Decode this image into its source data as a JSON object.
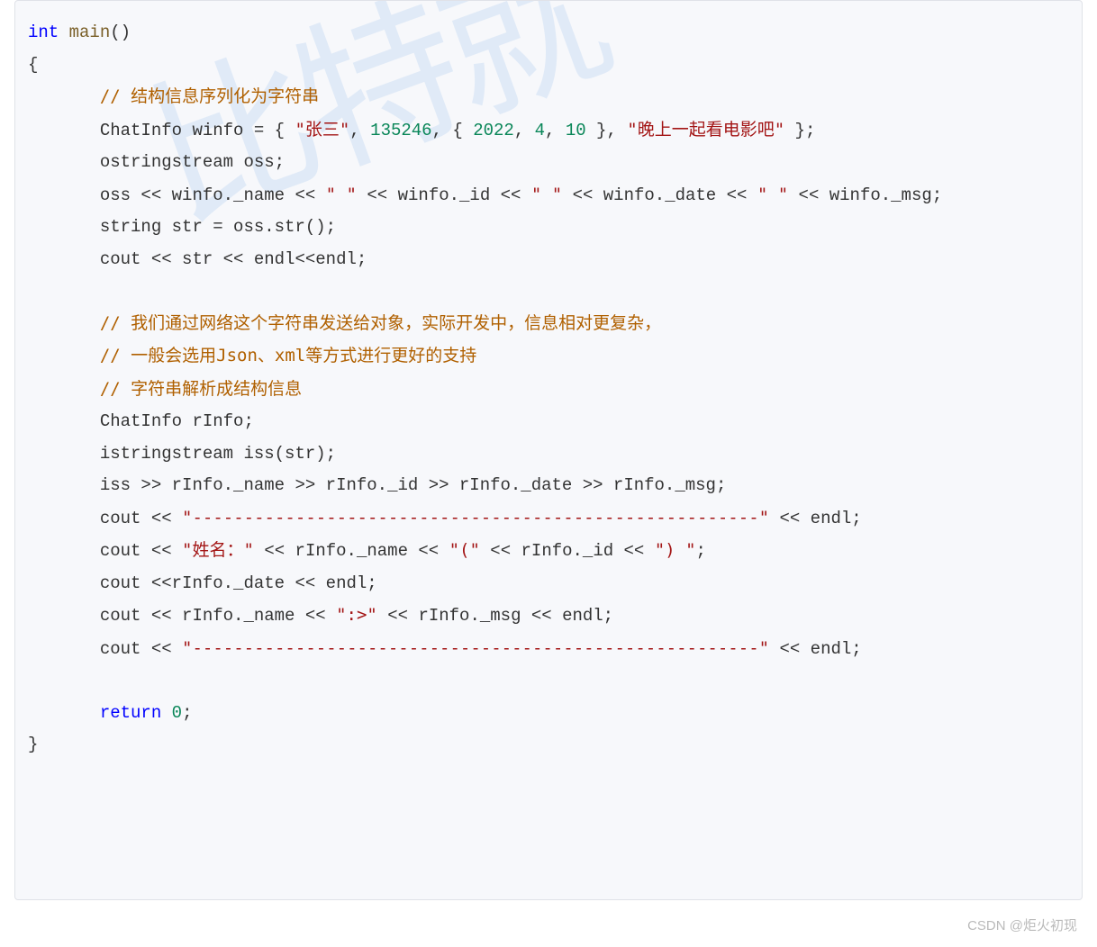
{
  "watermark": "比特就",
  "credit": "CSDN @炬火初现",
  "code": {
    "l1": {
      "kw": "int",
      "fn": "main",
      "rest": "()"
    },
    "l2": "{",
    "l3": "// 结构信息序列化为字符串",
    "l4": {
      "pre": "ChatInfo winfo = { ",
      "s1": "\"张三\"",
      "c1": ", ",
      "n1": "135246",
      "c2": ", { ",
      "n2": "2022",
      "c3": ", ",
      "n3": "4",
      "c4": ", ",
      "n4": "10",
      "c5": " }, ",
      "s2": "\"晚上一起看电影吧\"",
      "end": " };"
    },
    "l5": "ostringstream oss;",
    "l6": {
      "a": "oss << winfo._name << ",
      "s1": "\" \"",
      "b": " << winfo._id << ",
      "s2": "\" \"",
      "c": " << winfo._date << ",
      "s3": "\" \"",
      "d": " << winfo._msg;"
    },
    "l7": "string str = oss.str();",
    "l8": "cout << str << endl<<endl;",
    "l9": "// 我们通过网络这个字符串发送给对象，实际开发中，信息相对更复杂，",
    "l10": "// 一般会选用Json、xml等方式进行更好的支持",
    "l11": "// 字符串解析成结构信息",
    "l12": "ChatInfo rInfo;",
    "l13": "istringstream iss(str);",
    "l14": "iss >> rInfo._name >> rInfo._id >> rInfo._date >> rInfo._msg;",
    "l15": {
      "a": "cout << ",
      "s": "\"-------------------------------------------------------\"",
      "b": " << endl;"
    },
    "l16": {
      "a": "cout << ",
      "s1": "\"姓名：\"",
      "b": " << rInfo._name << ",
      "s2": "\"(\"",
      "c": " << rInfo._id << ",
      "s3": "\") \"",
      "d": ";"
    },
    "l17": "cout <<rInfo._date << endl;",
    "l18": {
      "a": "cout << rInfo._name << ",
      "s": "\":>\"",
      "b": " << rInfo._msg << endl;"
    },
    "l19": {
      "a": "cout << ",
      "s": "\"-------------------------------------------------------\"",
      "b": " << endl;"
    },
    "l20": {
      "kw": "return",
      "sp": " ",
      "n": "0",
      "end": ";"
    },
    "l21": "}"
  }
}
